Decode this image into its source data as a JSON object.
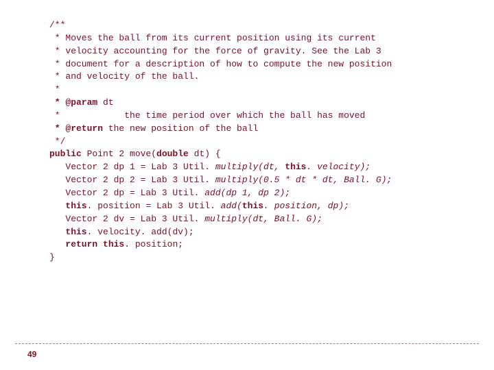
{
  "page_number": "49",
  "code": {
    "l01": "/**",
    "l02": " * Moves the ball from its current position using its current",
    "l03": " * velocity accounting for the force of gravity. See the Lab 3",
    "l04": " * document for a description of how to compute the new position",
    "l05": " * and velocity of the ball.",
    "l06": " * ",
    "l07_a": " * @param",
    "l07_b": " dt",
    "l08": " *            the time period over which the ball has moved",
    "l09_a": " * @return",
    "l09_b": " the new position of the ball",
    "l10": " */",
    "l11_kw1": "public",
    "l11_a": " Point 2 move(",
    "l11_kw2": "double",
    "l11_b": " dt) {",
    "l12_a": "   Vector 2 dp 1 = Lab 3 Util.",
    "l12_it": " multiply(dt, ",
    "l12_kw": "this",
    "l12_it2": ". velocity);",
    "l13_a": "   Vector 2 dp 2 = Lab 3 Util.",
    "l13_it": " multiply(0.5 * dt * dt, Ball. G);",
    "l14_a": "   Vector 2 dp = Lab 3 Util.",
    "l14_it": " add(dp 1, dp 2);",
    "l15_sp": "   ",
    "l15_kw": "this",
    "l15_a": ". position = Lab 3 Util.",
    "l15_it": " add(",
    "l15_kw2": "this",
    "l15_it2": ". position, dp);",
    "l16_a": "   Vector 2 dv = Lab 3 Util.",
    "l16_it": " multiply(dt, Ball. G);",
    "l17_sp": "   ",
    "l17_kw": "this",
    "l17_a": ". velocity. add(dv);",
    "l18_sp": "   ",
    "l18_kw": "return this",
    "l18_a": ". position;",
    "l19": "}"
  }
}
